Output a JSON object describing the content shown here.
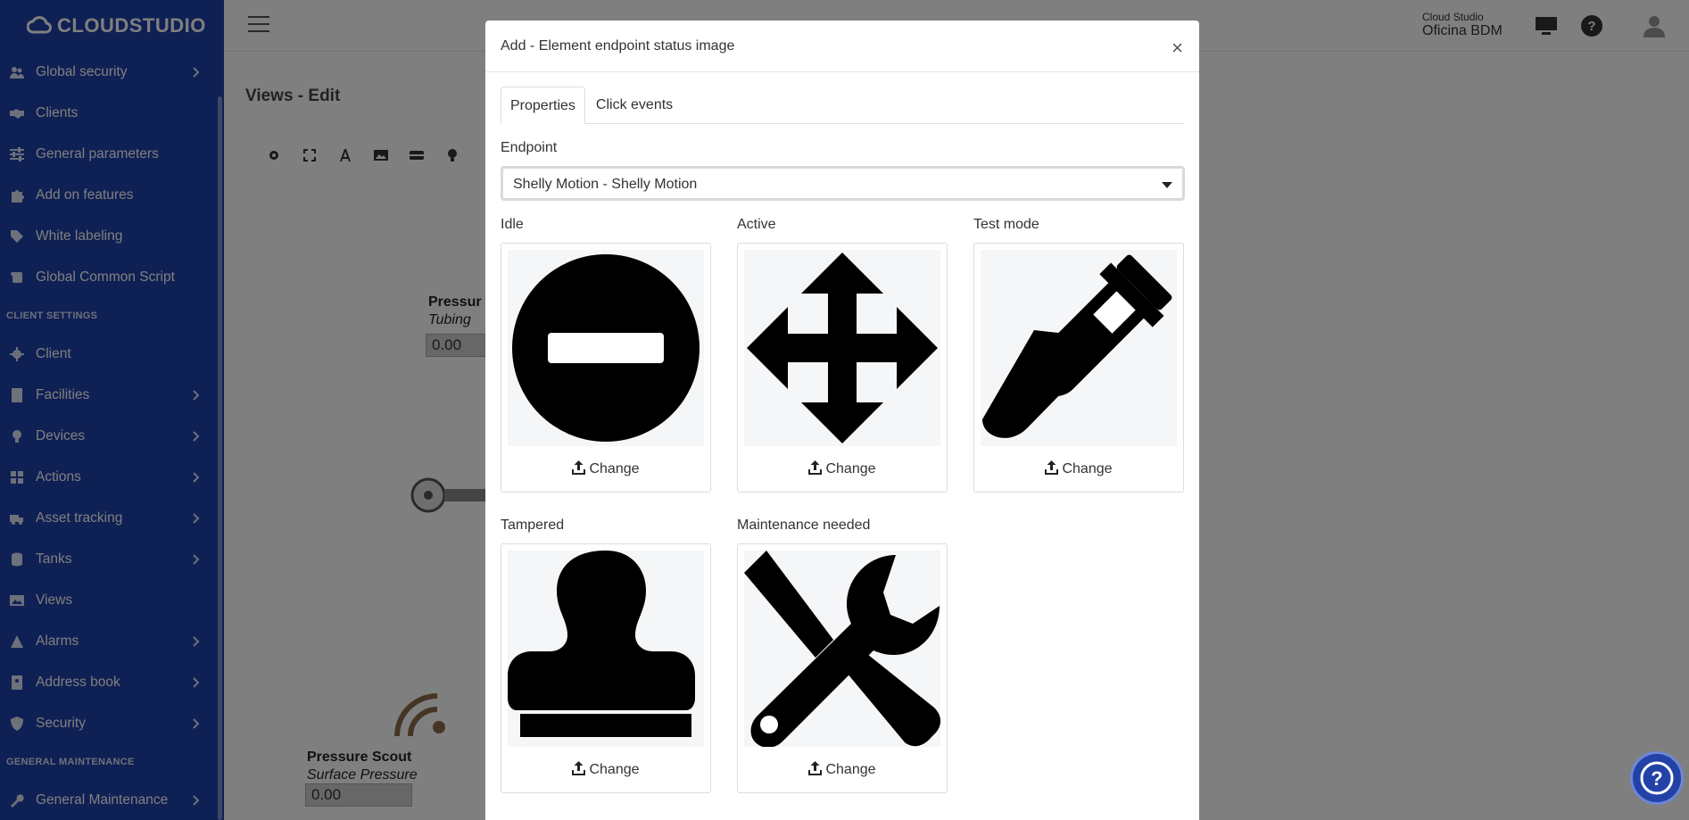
{
  "app": {
    "logo_text": "CLOUDSTUDIO"
  },
  "sidebar": {
    "items": [
      {
        "label": "Global security",
        "icon": "users-cog-icon",
        "has_children": true
      },
      {
        "label": "Clients",
        "icon": "handshake-icon",
        "has_children": false
      },
      {
        "label": "General parameters",
        "icon": "sliders-icon",
        "has_children": false
      },
      {
        "label": "Add on features",
        "icon": "puzzle-icon",
        "has_children": false
      },
      {
        "label": "White labeling",
        "icon": "tag-icon",
        "has_children": false
      },
      {
        "label": "Global Common Script",
        "icon": "scroll-icon",
        "has_children": false
      }
    ],
    "section_client": "CLIENT SETTINGS",
    "client_items": [
      {
        "label": "Client",
        "icon": "gear-icon",
        "has_children": false
      },
      {
        "label": "Facilities",
        "icon": "building-icon",
        "has_children": true
      },
      {
        "label": "Devices",
        "icon": "lightbulb-icon",
        "has_children": true
      },
      {
        "label": "Actions",
        "icon": "grid-icon",
        "has_children": true
      },
      {
        "label": "Asset tracking",
        "icon": "truck-icon",
        "has_children": true
      },
      {
        "label": "Tanks",
        "icon": "database-icon",
        "has_children": true
      },
      {
        "label": "Views",
        "icon": "image-icon",
        "has_children": false
      },
      {
        "label": "Alarms",
        "icon": "warning-icon",
        "has_children": true
      },
      {
        "label": "Address book",
        "icon": "address-book-icon",
        "has_children": true
      },
      {
        "label": "Security",
        "icon": "shield-icon",
        "has_children": true
      }
    ],
    "section_maint": "GENERAL MAINTENANCE",
    "maint_items": [
      {
        "label": "General Maintenance",
        "icon": "wrench-icon",
        "has_children": true
      }
    ]
  },
  "topbar": {
    "account_line1": "Cloud Studio",
    "account_line2": "Oficina BDM"
  },
  "page": {
    "title": "Views - Edit",
    "canvas": {
      "widget1_title": "Pressur",
      "widget1_subtitle": "Tubing",
      "widget1_value": "0.00",
      "widget2_title": "Pressure Scout",
      "widget2_subtitle": "Surface Pressure",
      "widget2_value": "0.00"
    }
  },
  "modal": {
    "title": "Add - Element endpoint status image",
    "close_symbol": "×",
    "tabs": [
      "Properties",
      "Click events"
    ],
    "endpoint_label": "Endpoint",
    "endpoint_value": "Shelly Motion - Shelly Motion",
    "change_label": "Change",
    "states": [
      {
        "label": "Idle",
        "icon": "minus-circle-icon"
      },
      {
        "label": "Active",
        "icon": "arrows-move-icon"
      },
      {
        "label": "Test mode",
        "icon": "test-tube-icon"
      },
      {
        "label": "Tampered",
        "icon": "stamp-icon"
      },
      {
        "label": "Maintenance needed",
        "icon": "tools-icon"
      }
    ]
  },
  "colors": {
    "sidebar_bg": "#1f40a8",
    "overlay": "rgba(0,0,0,0.5)",
    "accent": "#2342a8"
  }
}
